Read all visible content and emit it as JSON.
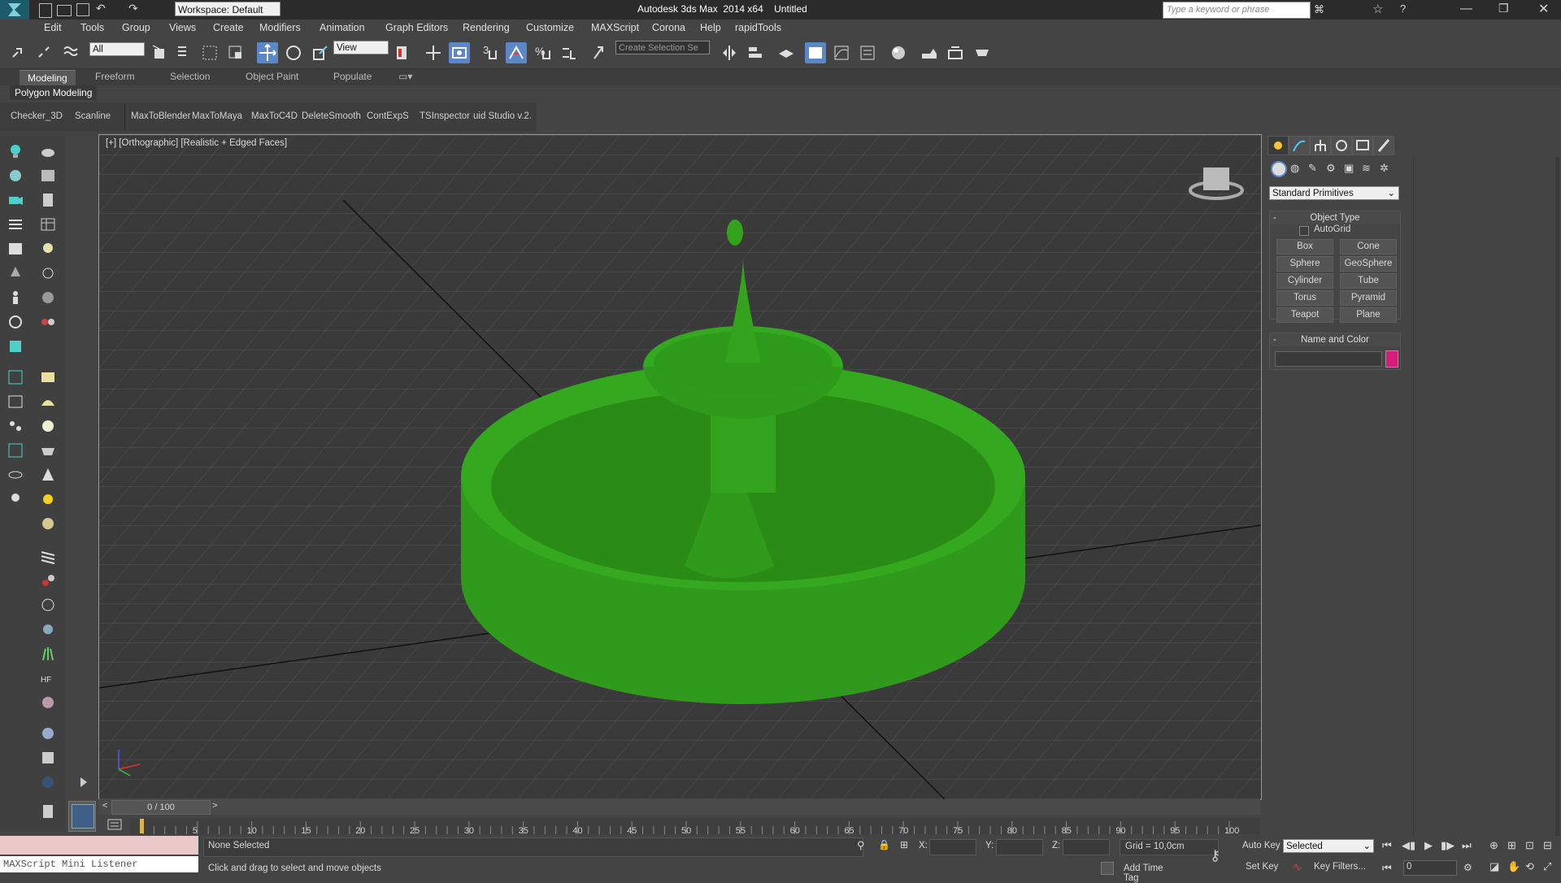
{
  "titlebar": {
    "workspace": "Workspace: Default",
    "title": "Autodesk 3ds Max  2014 x64    Untitled",
    "search_placeholder": "Type a keyword or phrase"
  },
  "menu": [
    "Edit",
    "Tools",
    "Group",
    "Views",
    "Create",
    "Modifiers",
    "Animation",
    "Graph Editors",
    "Rendering",
    "Customize",
    "MAXScript",
    "Corona",
    "Help",
    "rapidTools"
  ],
  "toolbar": {
    "filter_value": "All",
    "refcoord_value": "View",
    "selection_set_placeholder": "Create Selection Se"
  },
  "ribbon": {
    "tabs": [
      "Modeling",
      "Freeform",
      "Selection",
      "Object Paint",
      "Populate"
    ],
    "active_tab": "Modeling",
    "panel": "Polygon Modeling"
  },
  "scripts": [
    "Checker_3D",
    "Scanline",
    "MaxToBlender",
    "MaxToMaya",
    "MaxToC4D",
    "DeleteSmooth",
    "ContExpS",
    "TSInspector",
    "uid Studio v.2."
  ],
  "viewport": {
    "label": "[+] [Orthographic] [Realistic + Edged Faces]"
  },
  "command_panel": {
    "category": "Standard Primitives",
    "object_type_title": "Object Type",
    "autogrid": "AutoGrid",
    "buttons": [
      "Box",
      "Cone",
      "Sphere",
      "GeoSphere",
      "Cylinder",
      "Tube",
      "Torus",
      "Pyramid",
      "Teapot",
      "Plane"
    ],
    "name_color_title": "Name and Color",
    "color": "#d81b7a"
  },
  "timeline": {
    "frame": "0 / 100",
    "ticks": [
      "5",
      "10",
      "15",
      "20",
      "25",
      "30",
      "35",
      "40",
      "45",
      "50",
      "55",
      "60",
      "65",
      "70",
      "75",
      "80",
      "85",
      "90",
      "95",
      "100"
    ]
  },
  "status": {
    "listener": "MAXScript Mini Listener",
    "selection": "None Selected",
    "prompt": "Click and drag to select and move objects",
    "x_label": "X:",
    "y_label": "Y:",
    "z_label": "Z:",
    "grid": "Grid = 10,0cm",
    "add_time_tag": "Add Time Tag",
    "auto_key": "Auto Key",
    "set_key": "Set Key",
    "selected": "Selected",
    "key_filters": "Key Filters...",
    "frame_field": "0"
  }
}
